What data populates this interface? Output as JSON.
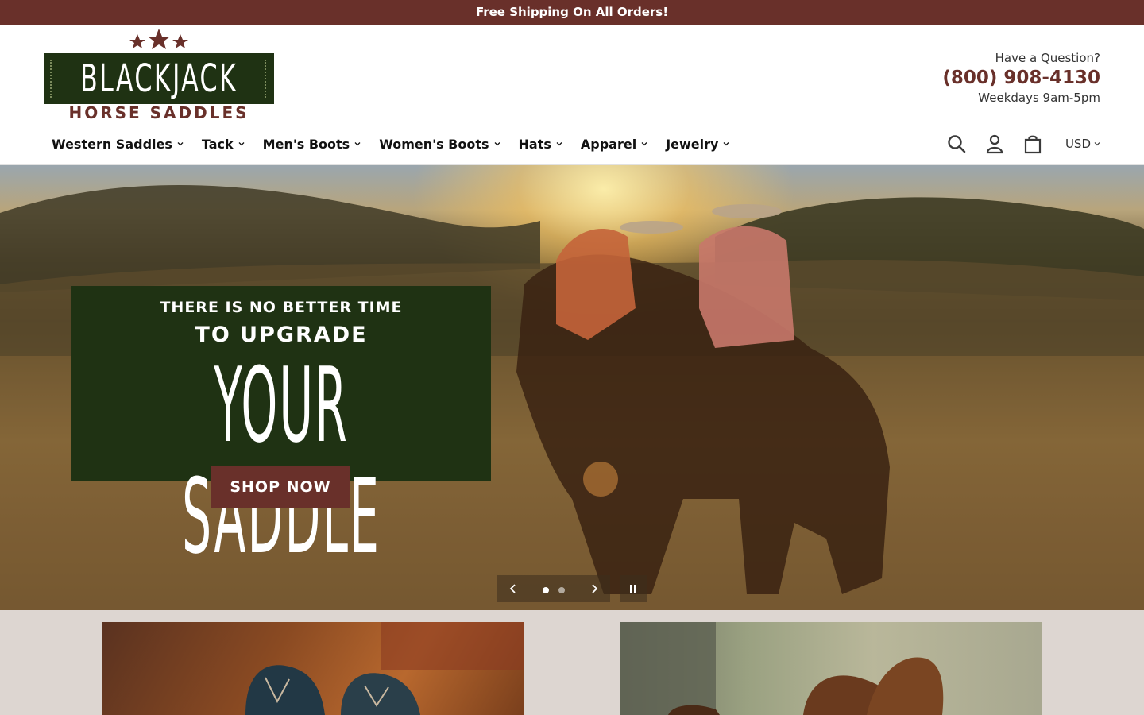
{
  "announcement": {
    "text": "Free Shipping On All Orders!"
  },
  "logo": {
    "brand": "BLACKJACK",
    "subtitle": "HORSE SADDLES"
  },
  "contact": {
    "question": "Have a Question?",
    "phone": "(800) 908-4130",
    "hours": "Weekdays 9am-5pm"
  },
  "nav": {
    "items": [
      {
        "label": "Western Saddles"
      },
      {
        "label": "Tack"
      },
      {
        "label": "Men's Boots"
      },
      {
        "label": "Women's Boots"
      },
      {
        "label": "Hats"
      },
      {
        "label": "Apparel"
      },
      {
        "label": "Jewelry"
      }
    ]
  },
  "utils": {
    "search_icon": "search-icon",
    "account_icon": "account-icon",
    "cart_icon": "cart-icon",
    "currency": "USD"
  },
  "hero": {
    "line1": "THERE IS NO BETTER TIME",
    "line2": "TO UPGRADE",
    "line3": "YOUR SADDLE",
    "button": "SHOP NOW",
    "slides_total": 2,
    "slide_active": 1
  },
  "colors": {
    "brand": "#69302a",
    "green": "#1f3213",
    "lower_bg": "#ddd6d1"
  }
}
